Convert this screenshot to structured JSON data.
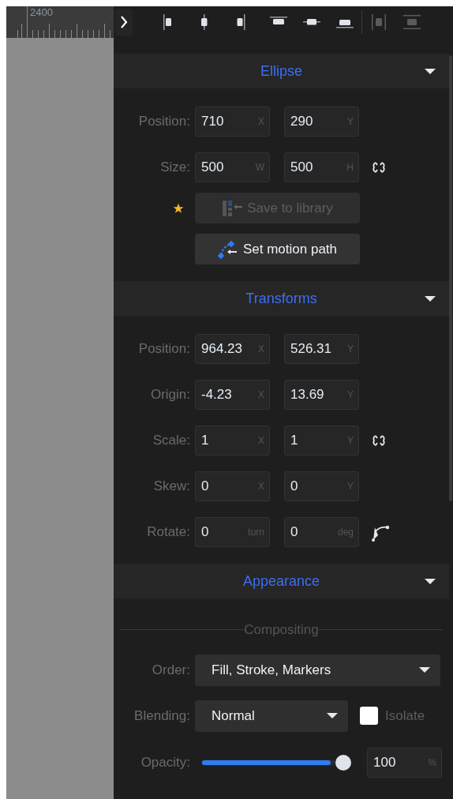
{
  "ruler": {
    "label": "2400"
  },
  "toolbar": {
    "items": [
      {
        "kind": "align-left",
        "disabled": false
      },
      {
        "kind": "align-center",
        "disabled": false
      },
      {
        "kind": "align-right",
        "disabled": false
      },
      {
        "kind": "align-top",
        "disabled": false
      },
      {
        "kind": "align-middle",
        "disabled": false
      },
      {
        "kind": "align-bottom",
        "disabled": false
      },
      {
        "kind": "distribute-horizontal",
        "disabled": true
      },
      {
        "kind": "distribute-vertical",
        "disabled": true
      }
    ]
  },
  "sections": [
    {
      "title": "Ellipse",
      "expanded": true,
      "rows": [
        {
          "kind": "pair",
          "label": "Position:",
          "fields": [
            {
              "value": "710",
              "unit": "X"
            },
            {
              "value": "290",
              "unit": "Y"
            }
          ]
        },
        {
          "kind": "linked",
          "label": "Size:",
          "fields": [
            {
              "value": "500",
              "unit": "W"
            },
            {
              "value": "500",
              "unit": "H"
            }
          ]
        },
        {
          "kind": "save",
          "label": "Save to library",
          "disabled": true,
          "starred": true
        },
        {
          "kind": "motion",
          "label": "Set motion path",
          "disabled": false,
          "starred": false
        }
      ]
    },
    {
      "title": "Transforms",
      "expanded": true,
      "rows": [
        {
          "kind": "pair",
          "label": "Position:",
          "fields": [
            {
              "value": "964.23",
              "unit": "X"
            },
            {
              "value": "526.31",
              "unit": "Y"
            }
          ]
        },
        {
          "kind": "pair",
          "label": "Origin:",
          "fields": [
            {
              "value": "-4.23",
              "unit": "X"
            },
            {
              "value": "13.69",
              "unit": "Y"
            }
          ]
        },
        {
          "kind": "linked",
          "label": "Scale:",
          "fields": [
            {
              "value": "1",
              "unit": "X"
            },
            {
              "value": "1",
              "unit": "Y"
            }
          ]
        },
        {
          "kind": "pair",
          "label": "Skew:",
          "fields": [
            {
              "value": "0",
              "unit": "X"
            },
            {
              "value": "0",
              "unit": "Y"
            }
          ]
        },
        {
          "kind": "rotate",
          "label": "Rotate:",
          "fields": [
            {
              "value": "0",
              "unit": "turn"
            },
            {
              "value": "0",
              "unit": "deg"
            }
          ]
        }
      ]
    },
    {
      "title": "Appearance",
      "expanded": true,
      "rows": [
        {
          "kind": "group",
          "label": "Compositing"
        },
        {
          "kind": "select",
          "label": "Order:",
          "value": "Fill, Stroke, Markers"
        },
        {
          "kind": "select",
          "label": "Blending:",
          "value": "Normal",
          "checkbox": {
            "label": "Isolate",
            "checked": false
          }
        },
        {
          "kind": "slider",
          "label": "Opacity:",
          "level": 1,
          "value": "100",
          "unit": "%"
        }
      ]
    }
  ]
}
